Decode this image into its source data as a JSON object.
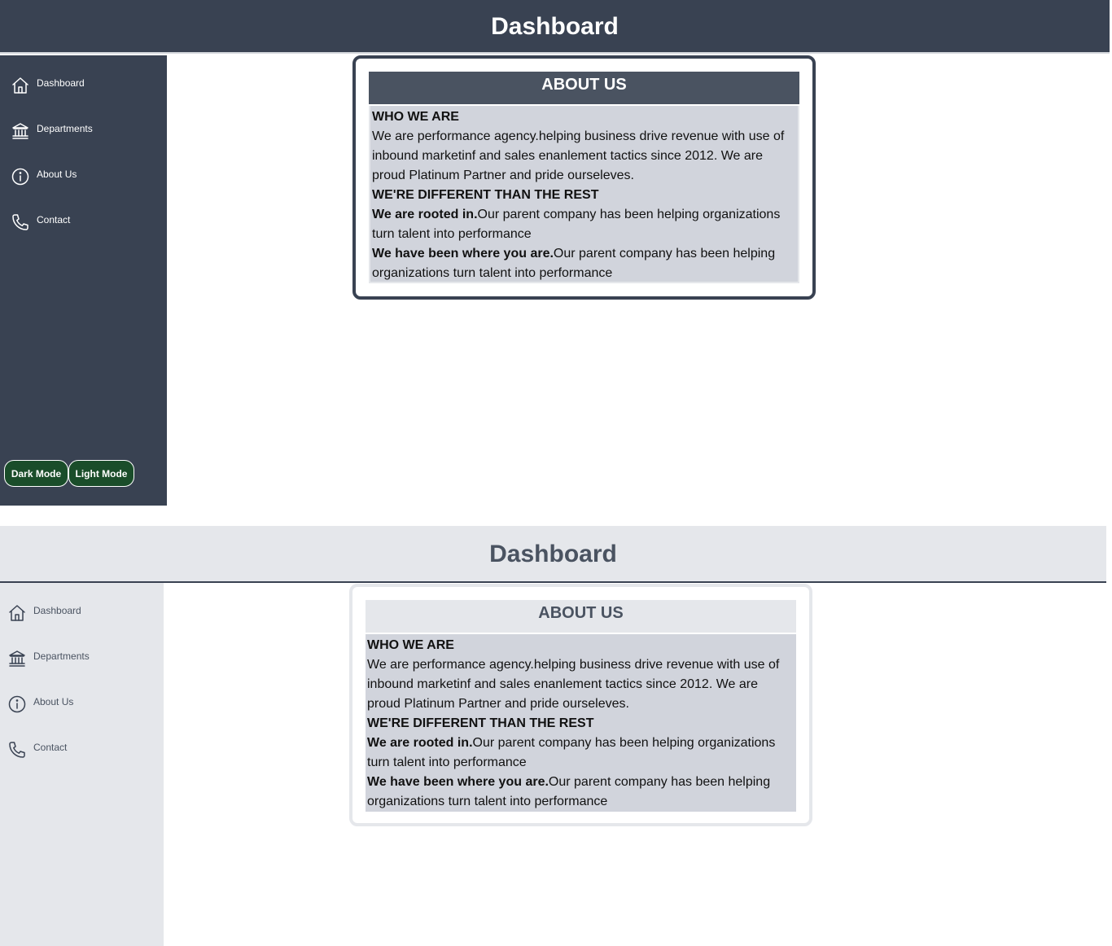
{
  "colors": {
    "dark_header": "#394252",
    "dark_sidebar": "#394252",
    "light_header": "#e5e7eb",
    "light_sidebar": "#e5e7eb",
    "card_body": "#d1d4dc",
    "mode_button": "#1a4d2a"
  },
  "dark": {
    "header": {
      "title": "Dashboard"
    },
    "sidebar": {
      "items": [
        {
          "label": "Dashboard",
          "icon": "home-icon"
        },
        {
          "label": "Departments",
          "icon": "building-icon"
        },
        {
          "label": "About Us",
          "icon": "info-icon"
        },
        {
          "label": "Contact",
          "icon": "phone-icon"
        }
      ],
      "dark_mode_label": "Dark Mode",
      "light_mode_label": "Light Mode"
    },
    "about": {
      "title": "ABOUT US",
      "who_heading": "WHO WE ARE",
      "who_text": "We are performance agency.helping business drive revenue with use of inbound marketinf and sales enanlement tactics since 2012. We are proud Platinum Partner and pride ourseleves.",
      "diff_heading": "WE'RE DIFFERENT THAN THE REST",
      "point1_lead": "We are rooted in.",
      "point1_text": "Our parent company has been helping organizations turn talent into performance",
      "point2_lead": "We have been where you are.",
      "point2_text": "Our parent company has been helping organizations turn talent into performance"
    }
  },
  "light": {
    "header": {
      "title": "Dashboard"
    },
    "sidebar": {
      "items": [
        {
          "label": "Dashboard",
          "icon": "home-icon"
        },
        {
          "label": "Departments",
          "icon": "building-icon"
        },
        {
          "label": "About Us",
          "icon": "info-icon"
        },
        {
          "label": "Contact",
          "icon": "phone-icon"
        }
      ]
    },
    "about": {
      "title": "ABOUT US",
      "who_heading": "WHO WE ARE",
      "who_text": "We are performance agency.helping business drive revenue with use of inbound marketinf and sales enanlement tactics since 2012. We are proud Platinum Partner and pride ourseleves.",
      "diff_heading": "WE'RE DIFFERENT THAN THE REST",
      "point1_lead": "We are rooted in.",
      "point1_text": "Our parent company has been helping organizations turn talent into performance",
      "point2_lead": "We have been where you are.",
      "point2_text": "Our parent company has been helping organizations turn talent into performance"
    }
  }
}
